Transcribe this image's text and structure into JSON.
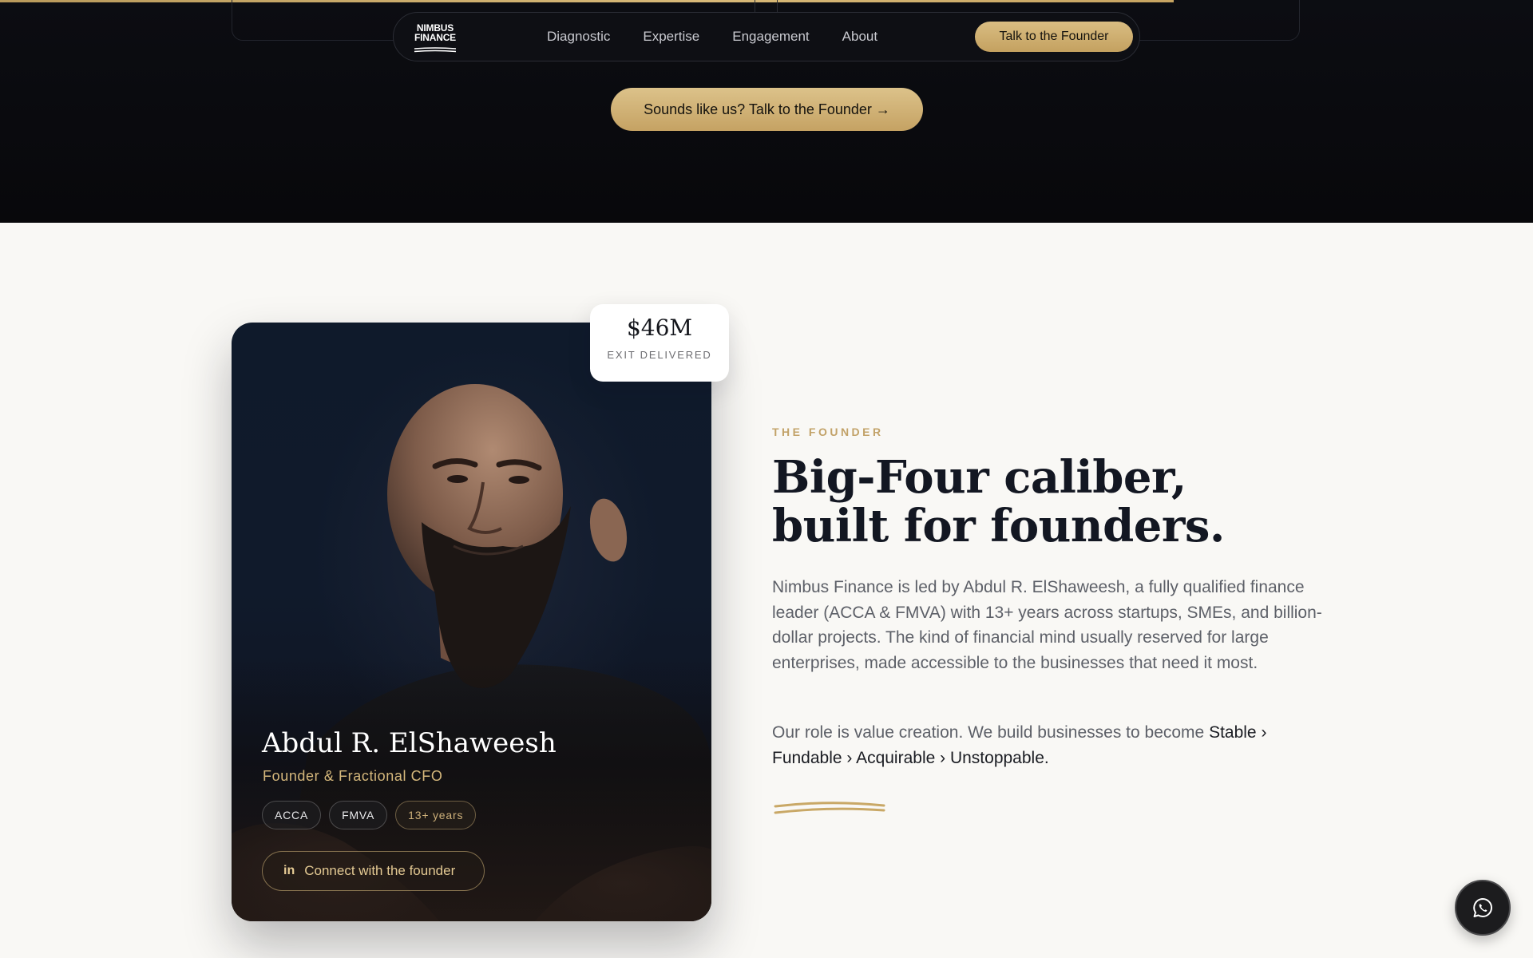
{
  "nav": {
    "logo_line1": "NIMBUS",
    "logo_line2": "FINANCE",
    "links": [
      "Diagnostic",
      "Expertise",
      "Engagement",
      "About"
    ],
    "cta_label": "Talk to the Founder"
  },
  "hero": {
    "cta_label": "Sounds like us? Talk to the Founder →"
  },
  "stat": {
    "value": "$46M",
    "label": "EXIT DELIVERED"
  },
  "founder_card": {
    "name": "Abdul R. ElShaweesh",
    "role": "Founder & Fractional CFO",
    "badges": [
      "ACCA",
      "FMVA",
      "13+ years"
    ],
    "connect_icon": "linkedin-icon",
    "connect_label": "Connect with the founder"
  },
  "founder_section": {
    "eyebrow": "THE FOUNDER",
    "headline": "Big-Four caliber, built for founders.",
    "body": "Nimbus Finance is led by Abdul R. ElShaweesh, a fully qualified finance leader (ACCA & FMVA) with 13+ years across startups, SMEs, and billion-dollar projects. The kind of financial mind usually reserved for large enterprises, made accessible to the businesses that need it most.",
    "body2_intro": "Our role is value creation. We build businesses to become ",
    "body2_emphasis": "Stable › Fundable › Acquirable › Unstoppable."
  },
  "colors": {
    "accent_gold": "#c9a866",
    "dark_bg": "#0b0c10",
    "light_bg": "#f9f8f5",
    "headline": "#131722"
  },
  "floating": {
    "whatsapp_icon": "whatsapp-icon"
  }
}
